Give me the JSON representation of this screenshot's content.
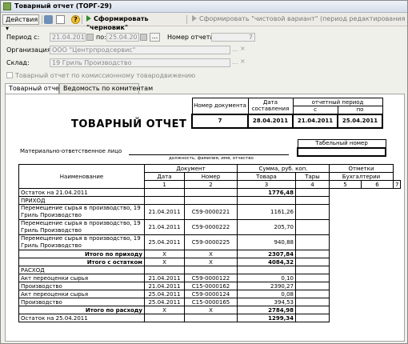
{
  "window": {
    "title": "Товарный отчет (ТОРГ-29)"
  },
  "toolbar": {
    "actions_label": "Действия",
    "help_glyph": "?",
    "draft_label": "Сформировать \"черновик\"",
    "final_label": "Сформировать \"чистовой вариант\" (период редактирования будет закрыт!!!)"
  },
  "form": {
    "period_label": "Период с:",
    "date_from": "21.04.2011",
    "to_label": "по:",
    "date_to": "25.04.2011",
    "dots": "...",
    "report_number_label": "Номер отчета:",
    "report_number": "7",
    "org_label": "Организация:",
    "org_value": "ООО \"Центрпродсервис\"",
    "warehouse_label": "Склад:",
    "warehouse_value": "19 Гриль Производство",
    "commission_checkbox_label": "Товарный отчет по комиссионному товародвижению",
    "clear_glyph": "...",
    "x_glyph": "×"
  },
  "tabs": [
    {
      "label": "Товарный отчет"
    },
    {
      "label": "Ведомость по комитентам"
    }
  ],
  "report": {
    "title": "ТОВАРНЫЙ ОТЧЕТ",
    "hdr_doc_number": "Номер документа",
    "hdr_date": "Дата составления",
    "hdr_period": "отчетный период",
    "hdr_from": "с",
    "hdr_to": "по",
    "val_number": "7",
    "val_date": "28.04.2011",
    "val_from": "21.04.2011",
    "val_to": "25.04.2011",
    "tab_number_label": "Табельный номер",
    "mol_label": "Материально-ответственное лицо",
    "mol_caption": "должность, фамилия, имя, отчество",
    "col_name": "Наименование",
    "col_document": "Документ",
    "col_date": "Дата",
    "col_number": "Номер",
    "col_sum": "Сумма, руб. коп.",
    "col_goods": "Товара",
    "col_tare": "Тары",
    "col_marks": "Отметки",
    "col_accounting": "Бухгалтерии",
    "idx": [
      "1",
      "2",
      "3",
      "4",
      "5",
      "6",
      "7"
    ],
    "opening": {
      "label": "Остаток на 21.04.2011",
      "value": "1776,48"
    },
    "income_label": "ПРИХОД",
    "income_rows": [
      {
        "name": "Перемещение сырья в производство, 19 Гриль Производство",
        "date": "21.04.2011",
        "number": "С59-0000221",
        "sum": "1161,26"
      },
      {
        "name": "Перемещение сырья в производство, 19 Гриль Производство",
        "date": "21.04.2011",
        "number": "С59-0000222",
        "sum": "205,70"
      },
      {
        "name": "Перемещение сырья в производство, 19 Гриль Производство",
        "date": "25.04.2011",
        "number": "С59-0000225",
        "sum": "940,88"
      }
    ],
    "income_total": {
      "label": "Итого по приходу",
      "x1": "X",
      "x2": "X",
      "value": "2307,84"
    },
    "with_balance": {
      "label": "Итого с остатком",
      "x1": "X",
      "x2": "X",
      "value": "4084,32"
    },
    "expense_label": "РАСХОД",
    "expense_rows": [
      {
        "name": "Акт переоценки сырья",
        "date": "21.04.2011",
        "number": "С59-0000122",
        "sum": "0,10"
      },
      {
        "name": "Производство",
        "date": "21.04.2011",
        "number": "С15-0000162",
        "sum": "2390,27"
      },
      {
        "name": "Акт переоценки сырья",
        "date": "25.04.2011",
        "number": "С59-0000124",
        "sum": "0,08"
      },
      {
        "name": "Производство",
        "date": "25.04.2011",
        "number": "С15-0000165",
        "sum": "394,53"
      }
    ],
    "expense_total": {
      "label": "Итого по расходу",
      "x1": "X",
      "x2": "X",
      "value": "2784,98"
    },
    "closing": {
      "label": "Остаток на 25.04.2011",
      "value": "1299,34"
    }
  }
}
